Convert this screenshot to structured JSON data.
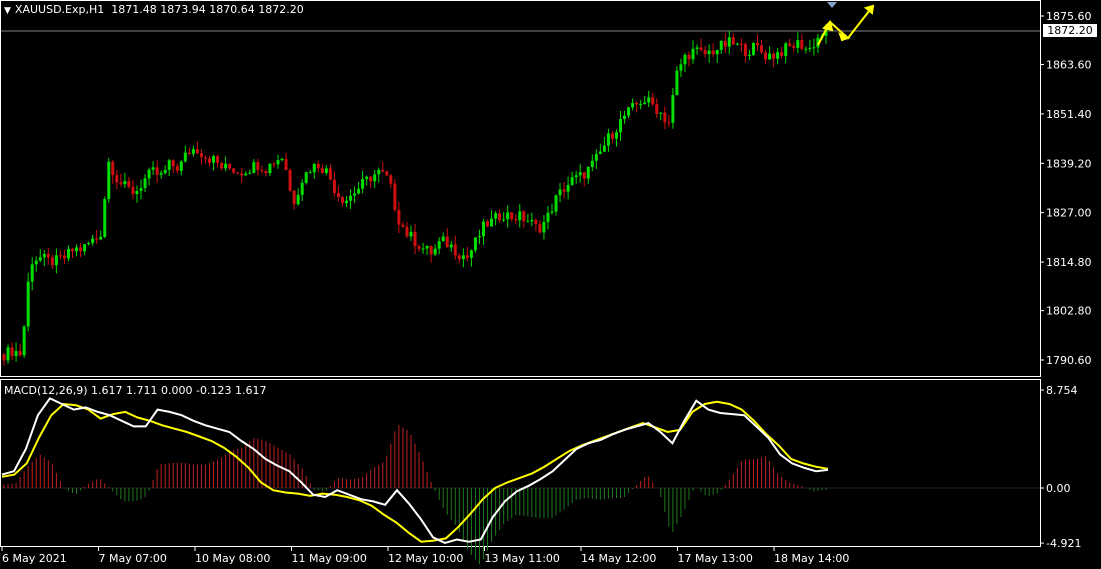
{
  "header": {
    "symbol": "XAUUSD.Exp,H1",
    "ohlc": "1871.48 1873.94 1870.64 1872.20"
  },
  "price_axis": {
    "labels": [
      "1875.60",
      "1863.60",
      "1851.40",
      "1839.20",
      "1827.00",
      "1814.80",
      "1802.80",
      "1790.60"
    ],
    "current_price": "1872.20"
  },
  "macd": {
    "label": "MACD(12,26,9) 1.617 1.711 0.000 -0.123 1.617",
    "axis_labels": [
      "8.754",
      "0.00",
      "-4.921"
    ]
  },
  "time_axis": {
    "labels": [
      "6 May 2021",
      "7 May 07:00",
      "10 May 08:00",
      "11 May 09:00",
      "12 May 10:00",
      "13 May 11:00",
      "14 May 12:00",
      "17 May 13:00",
      "18 May 14:00"
    ]
  },
  "colors": {
    "bull": "#00e000",
    "bear": "#d01010",
    "macd_line": "#ffffff",
    "signal_line": "#ffff00",
    "hist_pos": "#c02020",
    "hist_neg": "#1f7a1f",
    "arrow": "#ffff00",
    "grid": "#808080"
  },
  "chart_data": {
    "type": "candlestick",
    "price_series": [
      1792,
      1793,
      1792,
      1815,
      1816,
      1815,
      1815,
      1816,
      1818,
      1818,
      1820,
      1821,
      1840,
      1835,
      1833,
      1832,
      1835,
      1837,
      1836,
      1839,
      1838,
      1842,
      1843,
      1841,
      1840,
      1838,
      1838,
      1837,
      1838,
      1839,
      1838,
      1840,
      1841,
      1829,
      1835,
      1838,
      1839,
      1837,
      1832,
      1830,
      1832,
      1834,
      1836,
      1837,
      1835,
      1826,
      1822,
      1820,
      1818,
      1817,
      1820,
      1819,
      1817,
      1816,
      1820,
      1824,
      1825,
      1827,
      1826,
      1826,
      1825,
      1823,
      1825,
      1830,
      1833,
      1835,
      1836,
      1838,
      1841,
      1845,
      1848,
      1851,
      1853,
      1855,
      1854,
      1852,
      1849,
      1862,
      1866,
      1867,
      1866,
      1867,
      1868,
      1869,
      1868,
      1867,
      1868,
      1866,
      1866,
      1867,
      1868,
      1869,
      1867,
      1870,
      1872
    ],
    "macd_series": [
      1.2,
      1.5,
      3.5,
      6.5,
      8.0,
      7.5,
      7.0,
      7.2,
      6.8,
      6.5,
      6.0,
      5.5,
      5.5,
      7.0,
      6.8,
      6.5,
      6.0,
      5.6,
      5.3,
      5.0,
      4.2,
      3.5,
      2.6,
      2.0,
      1.5,
      0.5,
      -0.6,
      -0.8,
      -0.2,
      -0.6,
      -1.0,
      -1.2,
      -1.5,
      -0.2,
      -1.4,
      -2.8,
      -4.4,
      -4.9,
      -4.6,
      -4.8,
      -4.6,
      -2.6,
      -1.2,
      -0.3,
      0.2,
      0.8,
      1.5,
      2.5,
      3.5,
      4.0,
      4.3,
      4.8,
      5.2,
      5.5,
      5.8,
      5.0,
      4.0,
      6.0,
      7.8,
      7.0,
      6.7,
      6.6,
      6.5,
      5.5,
      4.5,
      3.0,
      2.2,
      1.8,
      1.5,
      1.617
    ],
    "signal_series": [
      1.0,
      1.2,
      2.2,
      4.5,
      6.5,
      7.5,
      7.4,
      7.0,
      6.2,
      6.6,
      6.8,
      6.3,
      6.0,
      5.6,
      5.3,
      5.0,
      4.6,
      4.2,
      3.6,
      2.8,
      1.8,
      0.5,
      -0.2,
      -0.4,
      -0.5,
      -0.7,
      -0.5,
      -0.6,
      -0.8,
      -1.1,
      -1.6,
      -2.4,
      -3.1,
      -4.0,
      -4.8,
      -4.7,
      -4.5,
      -3.5,
      -2.3,
      -1.0,
      0.0,
      0.5,
      0.9,
      1.3,
      1.9,
      2.6,
      3.3,
      3.8,
      4.2,
      4.6,
      5.0,
      5.4,
      5.8,
      5.4,
      5.0,
      5.2,
      6.8,
      7.5,
      7.7,
      7.5,
      7.0,
      6.0,
      4.8,
      3.8,
      2.6,
      2.2,
      1.9,
      1.711
    ],
    "macd_range": [
      -4.921,
      8.754
    ],
    "price_range": [
      1790.6,
      1875.6
    ]
  }
}
